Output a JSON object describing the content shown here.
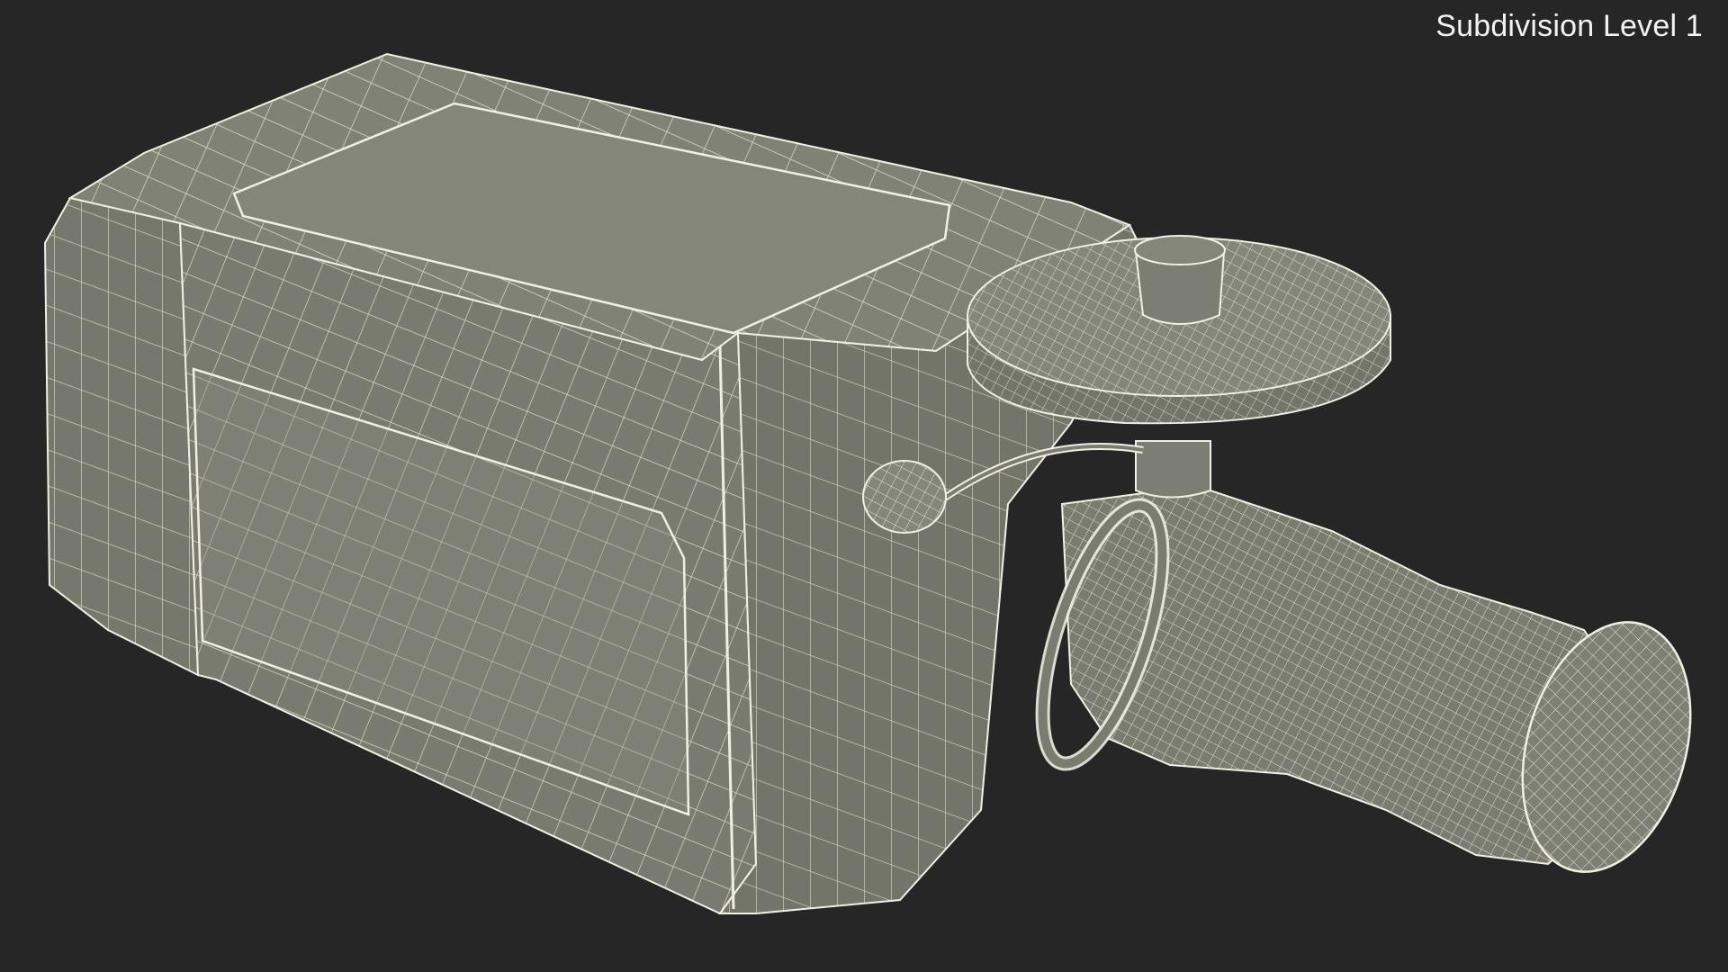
{
  "viewport": {
    "subdivision_label": "Subdivision Level 1"
  },
  "colors": {
    "background": "#262626",
    "surface": "#7c7d72",
    "surface_dark": "#6b6c61",
    "surface_light": "#8a8b80",
    "wire": "#f0efe2"
  },
  "model": {
    "name": "camcorder-wireframe"
  }
}
